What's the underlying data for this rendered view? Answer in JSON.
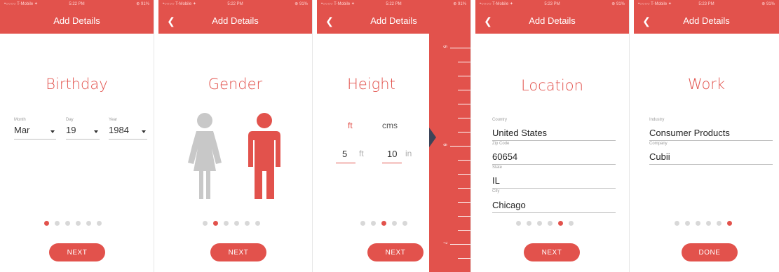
{
  "status": {
    "carrier": "•○○○○ T-Mobile ✦",
    "battery": "⊕ 91%"
  },
  "header_title": "Add Details",
  "next_label": "NEXT",
  "done_label": "DONE",
  "colors": {
    "accent": "#e2524c",
    "pointer": "#3d4458",
    "inactive_icon": "#c8c8c8"
  },
  "screens": [
    {
      "time": "5:22 PM",
      "title": "Birthday",
      "fields": [
        {
          "label": "Month",
          "value": "Mar"
        },
        {
          "label": "Day",
          "value": "19"
        },
        {
          "label": "Year",
          "value": "1984"
        }
      ],
      "active_dot": 1
    },
    {
      "time": "5:22 PM",
      "title": "Gender",
      "active_dot": 2
    },
    {
      "time": "5:22 PM",
      "title": "Height",
      "tabs": {
        "selected": "ft",
        "other": "cms"
      },
      "feet": {
        "value": "5",
        "unit": "ft"
      },
      "inches": {
        "value": "10",
        "unit": "in"
      },
      "ruler_labels": [
        "5",
        "6",
        "7"
      ],
      "active_dot": 3
    },
    {
      "time": "5:23 PM",
      "title": "Location",
      "fields": [
        {
          "label": "Country",
          "value": "United States"
        },
        {
          "label": "Zip Code",
          "value": "60654"
        },
        {
          "label": "State",
          "value": "IL"
        },
        {
          "label": "City",
          "value": "Chicago"
        }
      ],
      "active_dot": 5
    },
    {
      "time": "5:23 PM",
      "title": "Work",
      "fields": [
        {
          "label": "Industry",
          "value": "Consumer Products"
        },
        {
          "label": "Company",
          "value": "Cubii"
        }
      ],
      "active_dot": 6
    }
  ]
}
